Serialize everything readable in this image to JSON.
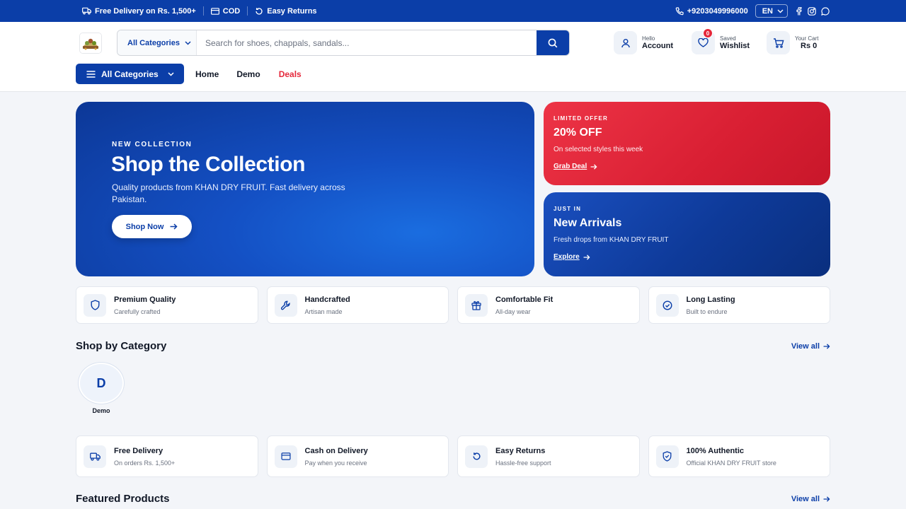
{
  "topbar": {
    "delivery": "Free Delivery on Rs. 1,500+",
    "cod": "COD",
    "returns": "Easy Returns",
    "phone": "+9203049996000",
    "language": "EN"
  },
  "header": {
    "search": {
      "category": "All Categories",
      "placeholder": "Search for shoes, chappals, sandals..."
    },
    "account": {
      "small": "Hello",
      "big": "Account"
    },
    "wishlist": {
      "small": "Saved",
      "big": "Wishlist",
      "count": "0"
    },
    "cart": {
      "small": "Your Cart",
      "big": "Rs 0"
    }
  },
  "nav": {
    "all_categories": "All Categories",
    "links": [
      "Home",
      "Demo",
      "Deals"
    ]
  },
  "hero": {
    "eyebrow": "NEW COLLECTION",
    "title": "Shop the Collection",
    "subtitle": "Quality products from KHAN DRY FRUIT. Fast delivery across Pakistan.",
    "cta": "Shop Now"
  },
  "promos": [
    {
      "eyebrow": "LIMITED OFFER",
      "title": "20% OFF",
      "desc": "On selected styles this week",
      "link": "Grab Deal"
    },
    {
      "eyebrow": "JUST IN",
      "title": "New Arrivals",
      "desc": "Fresh drops from KHAN DRY FRUIT",
      "link": "Explore"
    }
  ],
  "features": [
    {
      "title": "Premium Quality",
      "sub": "Carefully crafted",
      "icon": "shield-icon"
    },
    {
      "title": "Handcrafted",
      "sub": "Artisan made",
      "icon": "wrench-icon"
    },
    {
      "title": "Comfortable Fit",
      "sub": "All-day wear",
      "icon": "gift-icon"
    },
    {
      "title": "Long Lasting",
      "sub": "Built to endure",
      "icon": "check-circle-icon"
    }
  ],
  "shop_by_category": {
    "title": "Shop by Category",
    "view_all": "View all",
    "categories": [
      {
        "initial": "D",
        "label": "Demo"
      }
    ]
  },
  "services": [
    {
      "title": "Free Delivery",
      "sub": "On orders Rs. 1,500+",
      "icon": "truck-icon"
    },
    {
      "title": "Cash on Delivery",
      "sub": "Pay when you receive",
      "icon": "card-icon"
    },
    {
      "title": "Easy Returns",
      "sub": "Hassle-free support",
      "icon": "return-icon"
    },
    {
      "title": "100% Authentic",
      "sub": "Official KHAN DRY FRUIT store",
      "icon": "shield-check-icon"
    }
  ],
  "featured": {
    "title": "Featured Products",
    "view_all": "View all"
  },
  "colors": {
    "primary": "#0b3ea8",
    "accent_red": "#e5283b",
    "page_bg": "#f3f5f9"
  }
}
